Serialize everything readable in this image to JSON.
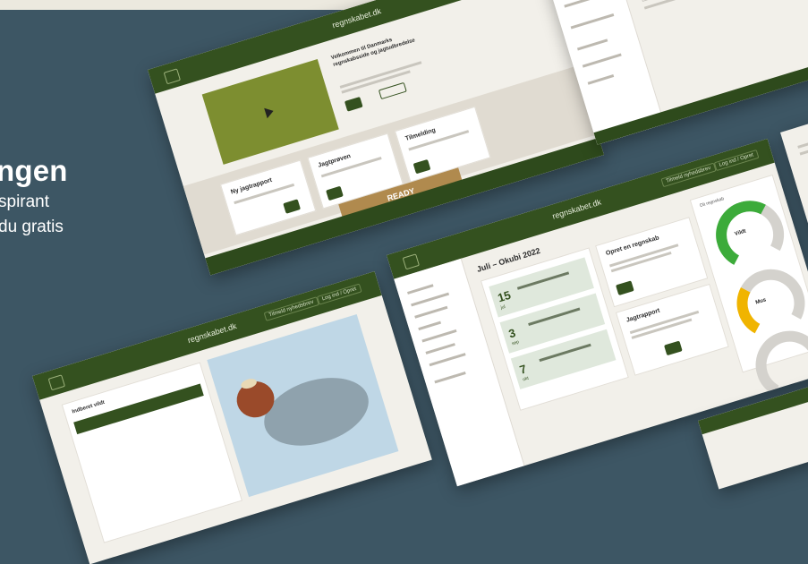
{
  "hero": {
    "title_fragment": "ngen",
    "text_line1": "spirant",
    "text_line2": "du gratis"
  },
  "site": {
    "name": "regnskabet.dk",
    "top_buttons": [
      "Tilmeld nyhedsbrev",
      "Log ind / Opret"
    ]
  },
  "mock1": {
    "headline": "Velkommen til Danmarks regnskabsside og jagtudbredelse",
    "card1": "Ny jagtrapport",
    "card2": "Jagtprøven",
    "card3": "Tilmelding",
    "banner": "READY"
  },
  "mock2": {
    "date_title": "Juli – Okubi 2022",
    "events": [
      {
        "day": "15",
        "mon": "jul"
      },
      {
        "day": "3",
        "mon": "sep"
      },
      {
        "day": "7",
        "mon": "okt"
      }
    ],
    "card_a": "Opret en regnskab",
    "card_b": "Jagtrapport",
    "stat_title": "Dit regnskab",
    "gauge1": "Vildt",
    "gauge2": "Mus",
    "colors": {
      "green": "#3cab3a",
      "yellow": "#f0b400",
      "grey": "#d4d2cd"
    }
  },
  "mock3": {
    "title": "Indberet vildt"
  }
}
